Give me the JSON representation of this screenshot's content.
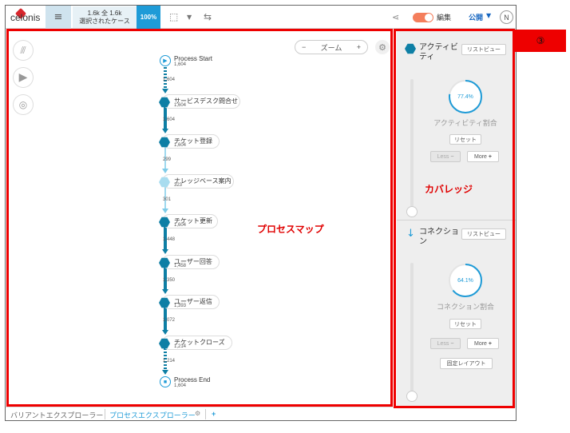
{
  "topbar": {
    "logo_text": "celonis",
    "cases_line1": "1.6k 全 1.6k",
    "cases_line2": "選択されたケース",
    "percentage": "100%",
    "edit_label": "編集",
    "publish_label": "公開",
    "avatar_initial": "N"
  },
  "map": {
    "zoom_label": "ズーム",
    "zoom_minus": "−",
    "zoom_plus": "+",
    "start": {
      "name": "Process Start",
      "count": "1,604"
    },
    "end": {
      "name": "Process End",
      "count": "1,604"
    },
    "activities": [
      {
        "name": "サービスデスク問合せ",
        "count": "1,604",
        "color": "#0e7fa5"
      },
      {
        "name": "チケット登録",
        "count": "1,604",
        "color": "#0e7fa5"
      },
      {
        "name": "ナレッジベース案内",
        "count": "323",
        "color": "#a8dcef"
      },
      {
        "name": "チケット更新",
        "count": "1,604",
        "color": "#0e7fa5"
      },
      {
        "name": "ユーザー回答",
        "count": "1,458",
        "color": "#0e7fa5"
      },
      {
        "name": "ユーザー返信",
        "count": "1,393",
        "color": "#0e7fa5"
      },
      {
        "name": "チケットクローズ",
        "count": "1,214",
        "color": "#0e7fa5"
      }
    ],
    "edges": [
      "1,604",
      "1,604",
      "299",
      "301",
      "1,448",
      "1,350",
      "1,072",
      "1,214"
    ]
  },
  "annotations": {
    "process_map": "プロセスマップ",
    "coverage": "カバレッジ",
    "badge": "③"
  },
  "panel": {
    "activity_title": "アクティビティ",
    "activity_list_btn": "リストビュー",
    "activity_pct_value": 0.774,
    "activity_pct": "77.4%",
    "activity_ratio_label": "アクティビティ割合",
    "reset_label": "リセット",
    "less_label": "Less",
    "more_label": "More",
    "connection_title": "コネクション",
    "connection_list_btn": "リストビュー",
    "connection_pct_value": 0.641,
    "connection_pct": "64.1%",
    "connection_ratio_label": "コネクション割合",
    "fixed_layout_label": "固定レイアウト"
  },
  "tabs": {
    "variant_explorer": "バリアントエクスプローラー",
    "process_explorer": "プロセスエクスプローラー",
    "add": "+"
  }
}
